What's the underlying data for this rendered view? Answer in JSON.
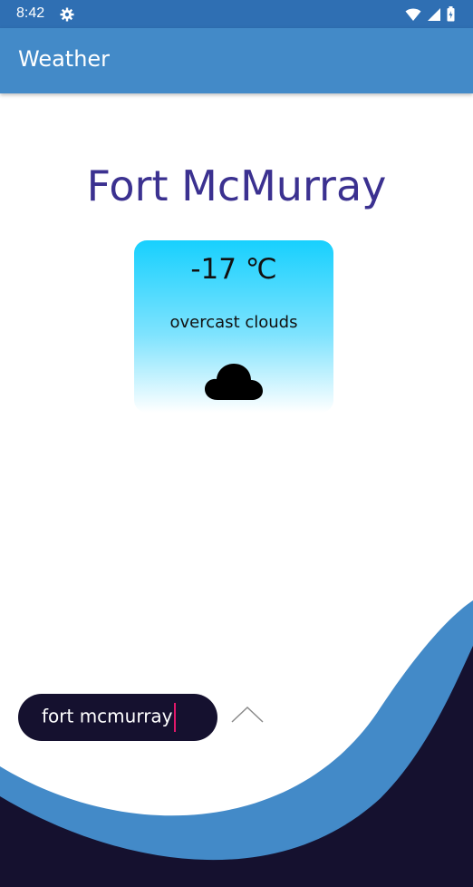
{
  "status_bar": {
    "time": "8:42",
    "icons": [
      "gear-icon",
      "wifi-icon",
      "signal-icon",
      "battery-icon"
    ]
  },
  "app_bar": {
    "title": "Weather"
  },
  "weather": {
    "city": "Fort McMurray",
    "temperature": "-17 ℃",
    "description": "overcast clouds",
    "icon": "cloud-icon"
  },
  "search": {
    "value": "fort mcmurray"
  },
  "colors": {
    "status_bar": "#2f6fb3",
    "app_bar": "#438ac8",
    "city_text": "#3b3190",
    "card_top": "#17d0fe",
    "wave_light": "#438ac8",
    "wave_dark": "#15112f",
    "caret": "#e0186a"
  }
}
